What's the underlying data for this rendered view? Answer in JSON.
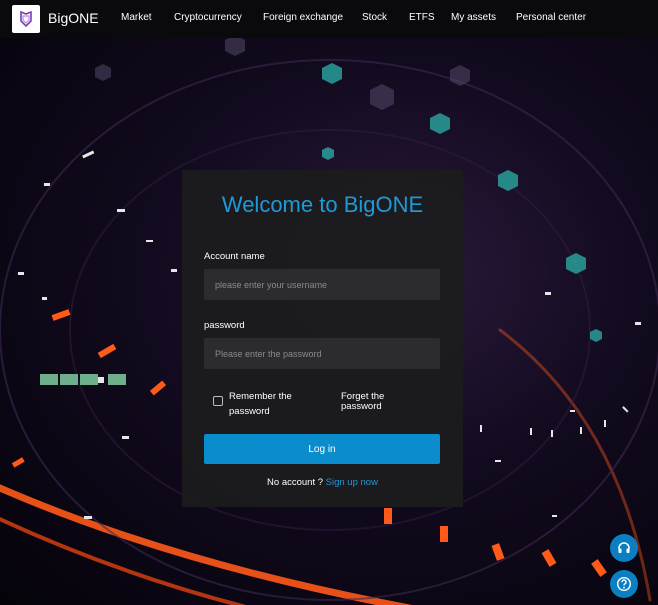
{
  "navbar": {
    "brand": "BigONE",
    "items": [
      {
        "label": "Market"
      },
      {
        "label": "Cryptocurrency"
      },
      {
        "label": "Foreign exchange"
      },
      {
        "label": "Stock"
      },
      {
        "label": "ETFS"
      },
      {
        "label": "My assets"
      },
      {
        "label": "Personal center"
      }
    ]
  },
  "login": {
    "title": "Welcome to BigONE",
    "account_label": "Account name",
    "account_placeholder": "please enter your username",
    "account_value": "",
    "password_label": "password",
    "password_placeholder": "Please enter the password",
    "password_value": "",
    "remember_label": "Remember the password",
    "remember_checked": false,
    "forget_label": "Forget the password",
    "login_button": "Log in",
    "no_account_text": "No account ?",
    "signup_link": "Sign up now"
  },
  "icons": {
    "logo": "bigone-logo-icon",
    "support": "headset-icon",
    "help": "question-mark-icon"
  },
  "colors": {
    "accent": "#1e9ad6",
    "button": "#0b8ccc",
    "navbar": "#0a0a0c",
    "card": "#1c1c1e",
    "input": "#2c2c2e"
  }
}
